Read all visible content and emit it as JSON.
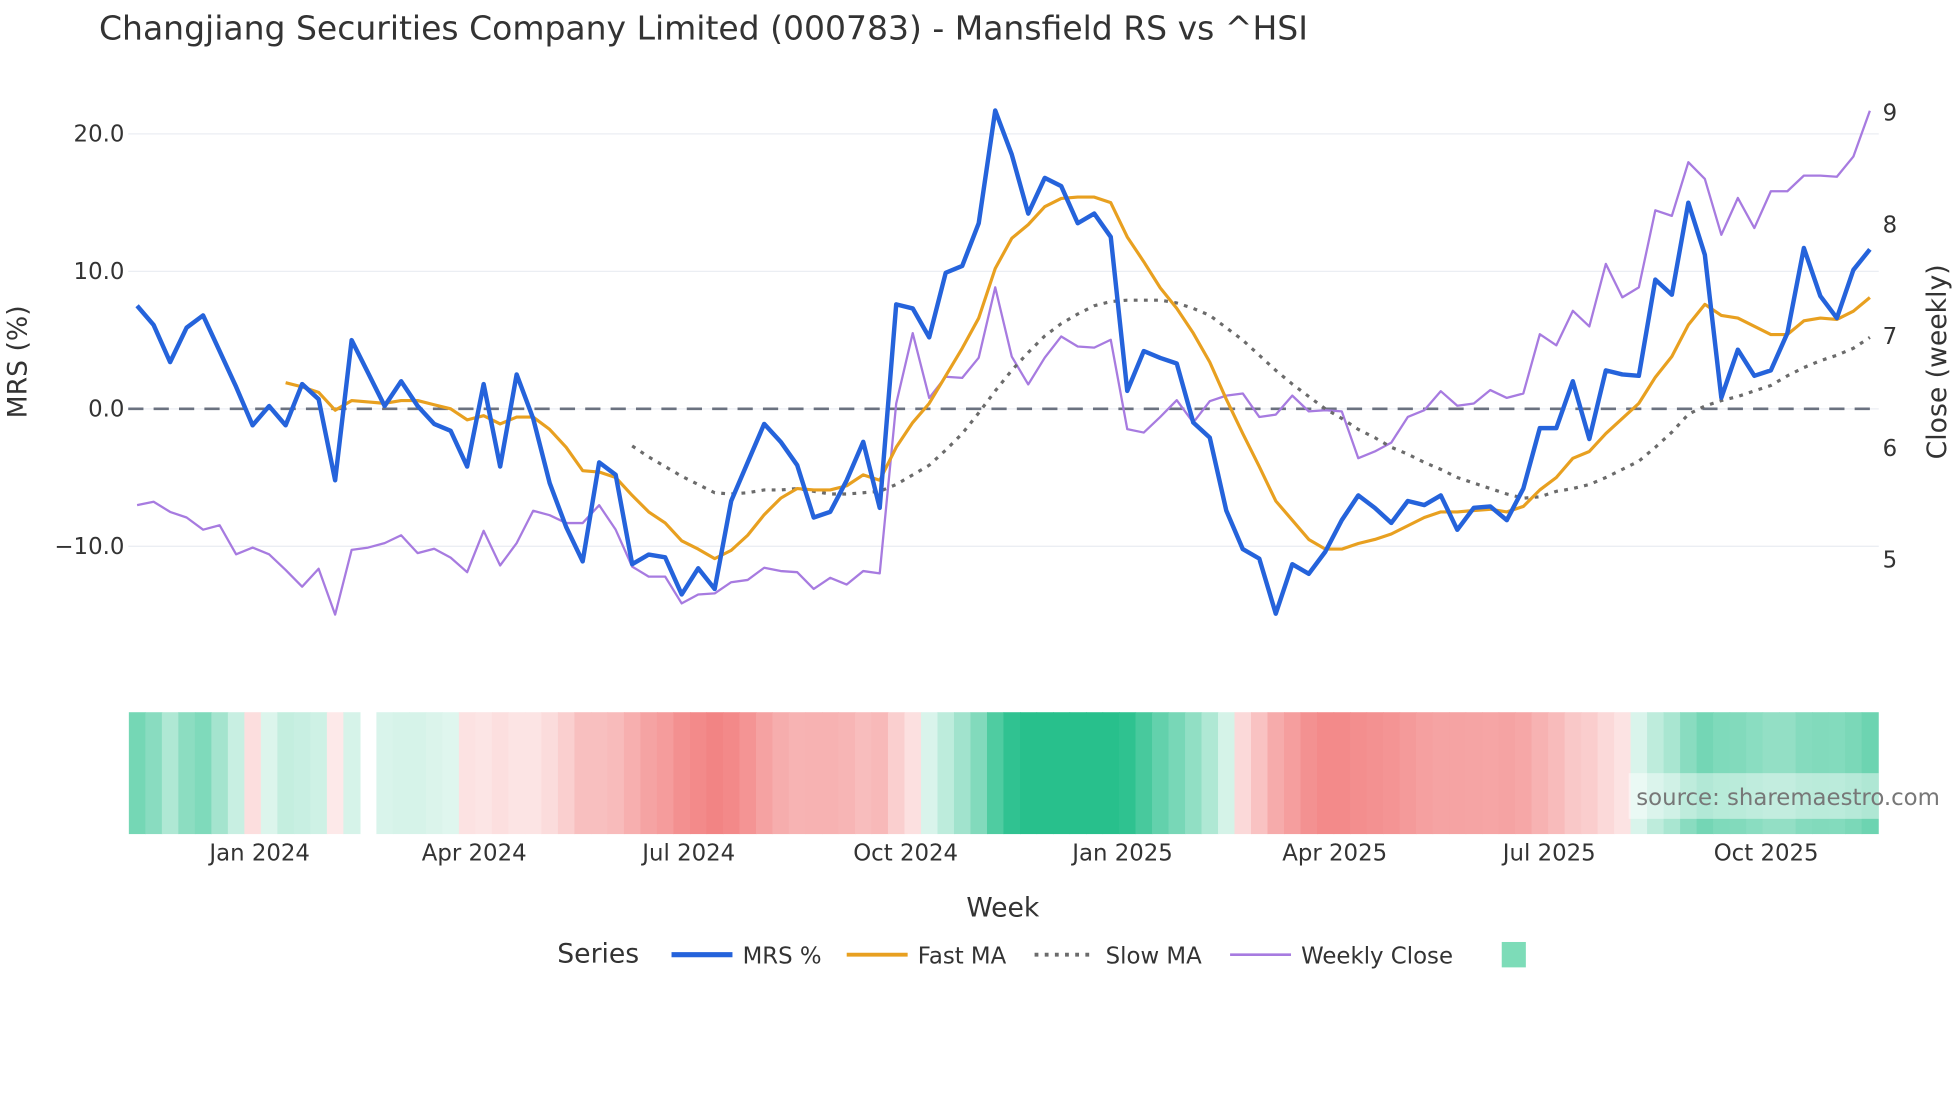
{
  "chart_data": {
    "type": "line",
    "title": "Changjiang Securities Company Limited (000783) - Mansfield RS vs ^HSI",
    "xlabel": "Week",
    "ylabel": "MRS (%)",
    "y2label": "Close (weekly)",
    "ylim": [
      -17.5,
      22.5
    ],
    "y2lim": [
      4.3,
      9.1
    ],
    "yticks": [
      {
        "v": 20,
        "label": "20.0"
      },
      {
        "v": 10,
        "label": "10.0"
      },
      {
        "v": 0,
        "label": "0.0"
      },
      {
        "v": -10,
        "label": "−10.0"
      }
    ],
    "y2ticks": [
      {
        "v": 9,
        "label": "9"
      },
      {
        "v": 8,
        "label": "8"
      },
      {
        "v": 7,
        "label": "7"
      },
      {
        "v": 6,
        "label": "6"
      },
      {
        "v": 5,
        "label": "5"
      }
    ],
    "xticks": [
      {
        "date": "2024-01-01",
        "label": "Jan 2024"
      },
      {
        "date": "2024-04-01",
        "label": "Apr 2024"
      },
      {
        "date": "2024-07-01",
        "label": "Jul 2024"
      },
      {
        "date": "2024-10-01",
        "label": "Oct 2024"
      },
      {
        "date": "2025-01-01",
        "label": "Jan 2025"
      },
      {
        "date": "2025-04-01",
        "label": "Apr 2025"
      },
      {
        "date": "2025-07-01",
        "label": "Jul 2025"
      },
      {
        "date": "2025-10-01",
        "label": "Oct 2025"
      }
    ],
    "first_week": "2023-11-10",
    "grid": true,
    "zero_line": true,
    "legend": {
      "title": "Series",
      "placement": "bottom-center"
    },
    "series": [
      {
        "name": "MRS %",
        "color": "#2563db",
        "values": [
          7.5,
          6.1,
          3.4,
          5.9,
          6.8,
          4.2,
          1.6,
          -1.2,
          0.2,
          -1.2,
          1.8,
          0.7,
          -5.2,
          5.0,
          2.6,
          0.2,
          2.0,
          0.2,
          -1.1,
          -1.6,
          -4.2,
          1.8,
          -4.2,
          2.5,
          -0.7,
          -5.4,
          -8.6,
          -11.1,
          -3.9,
          -4.8,
          -11.3,
          -10.6,
          -10.8,
          -13.5,
          -11.6,
          -13.1,
          -6.7,
          -3.9,
          -1.1,
          -2.4,
          -4.1,
          -7.9,
          -7.5,
          -5.2,
          -2.4,
          -7.2,
          7.6,
          7.3,
          5.2,
          9.9,
          10.4,
          13.5,
          21.7,
          18.5,
          14.2,
          16.8,
          16.2,
          13.5,
          14.2,
          12.5,
          1.3,
          4.2,
          3.7,
          3.3,
          -1.0,
          -2.1,
          -7.4,
          -10.2,
          -10.9,
          -14.9,
          -11.3,
          -12.0,
          -10.4,
          -8.1,
          -6.3,
          -7.2,
          -8.3,
          -6.7,
          -7.0,
          -6.3,
          -8.8,
          -7.2,
          -7.1,
          -8.1,
          -5.8,
          -1.4,
          -1.4,
          2.0,
          -2.2,
          2.8,
          2.5,
          2.4,
          9.4,
          8.3,
          15.0,
          11.2,
          0.8,
          4.3,
          2.4,
          2.8,
          5.5,
          11.7,
          8.2,
          6.6,
          10.1,
          11.6
        ]
      },
      {
        "name": "Fast MA",
        "color": "#e8a020",
        "values": [
          null,
          null,
          null,
          null,
          null,
          null,
          null,
          null,
          null,
          1.9,
          1.6,
          1.2,
          -0.1,
          0.6,
          0.5,
          0.4,
          0.6,
          0.6,
          0.3,
          0.0,
          -0.8,
          -0.5,
          -1.1,
          -0.6,
          -0.6,
          -1.5,
          -2.8,
          -4.5,
          -4.6,
          -5.0,
          -6.3,
          -7.5,
          -8.3,
          -9.6,
          -10.2,
          -10.9,
          -10.3,
          -9.2,
          -7.7,
          -6.5,
          -5.8,
          -5.9,
          -5.9,
          -5.6,
          -4.8,
          -5.2,
          -2.8,
          -1.0,
          0.4,
          2.4,
          4.4,
          6.6,
          10.2,
          12.4,
          13.4,
          14.7,
          15.3,
          15.4,
          15.4,
          15.0,
          12.5,
          10.7,
          8.8,
          7.3,
          5.5,
          3.4,
          0.7,
          -1.8,
          -4.2,
          -6.7,
          -8.1,
          -9.5,
          -10.2,
          -10.2,
          -9.8,
          -9.5,
          -9.1,
          -8.5,
          -7.9,
          -7.5,
          -7.5,
          -7.4,
          -7.3,
          -7.5,
          -7.1,
          -5.9,
          -5.0,
          -3.6,
          -3.1,
          -1.8,
          -0.7,
          0.4,
          2.3,
          3.8,
          6.1,
          7.6,
          6.8,
          6.6,
          6.0,
          5.4,
          5.4,
          6.4,
          6.6,
          6.5,
          7.1,
          8.1
        ]
      },
      {
        "name": "Slow MA",
        "color": "#6b6b6b",
        "dash": true,
        "values": [
          null,
          null,
          null,
          null,
          null,
          null,
          null,
          null,
          null,
          null,
          null,
          null,
          null,
          null,
          null,
          null,
          null,
          null,
          null,
          null,
          null,
          null,
          null,
          null,
          null,
          null,
          null,
          null,
          null,
          null,
          -2.7,
          -3.5,
          -4.2,
          -4.9,
          -5.5,
          -6.1,
          -6.2,
          -6.1,
          -5.9,
          -5.9,
          -5.8,
          -6.0,
          -6.2,
          -6.2,
          -6.1,
          -6.0,
          -5.5,
          -4.8,
          -4.1,
          -3.0,
          -1.8,
          -0.3,
          1.3,
          2.8,
          4.1,
          5.3,
          6.2,
          6.9,
          7.5,
          7.8,
          7.9,
          7.9,
          7.9,
          7.7,
          7.3,
          6.8,
          5.9,
          5.0,
          3.9,
          2.8,
          1.8,
          0.9,
          0.0,
          -0.7,
          -1.5,
          -2.1,
          -2.8,
          -3.3,
          -3.9,
          -4.4,
          -5.0,
          -5.4,
          -5.8,
          -6.2,
          -6.5,
          -6.4,
          -6.0,
          -5.8,
          -5.5,
          -5.0,
          -4.4,
          -3.8,
          -2.8,
          -1.7,
          -0.4,
          0.2,
          0.6,
          0.9,
          1.3,
          1.7,
          2.4,
          3.0,
          3.5,
          3.9,
          4.4,
          5.2
        ]
      },
      {
        "name": "Weekly Close",
        "color": "#a77be0",
        "axis": "right",
        "values": [
          5.49,
          5.52,
          5.43,
          5.38,
          5.27,
          5.31,
          5.05,
          5.11,
          5.05,
          4.91,
          4.76,
          4.92,
          4.51,
          5.09,
          5.11,
          5.15,
          5.22,
          5.06,
          5.1,
          5.02,
          4.89,
          5.26,
          4.95,
          5.15,
          5.44,
          5.4,
          5.33,
          5.33,
          5.49,
          5.27,
          4.94,
          4.85,
          4.85,
          4.61,
          4.69,
          4.7,
          4.8,
          4.82,
          4.93,
          4.9,
          4.89,
          4.74,
          4.84,
          4.78,
          4.9,
          4.88,
          6.4,
          7.03,
          6.45,
          6.64,
          6.63,
          6.81,
          7.44,
          6.82,
          6.57,
          6.81,
          7.0,
          6.91,
          6.9,
          6.97,
          6.17,
          6.14,
          6.28,
          6.43,
          6.23,
          6.42,
          6.47,
          6.49,
          6.28,
          6.3,
          6.47,
          6.33,
          6.34,
          6.33,
          5.91,
          5.97,
          6.05,
          6.28,
          6.34,
          6.51,
          6.38,
          6.4,
          6.52,
          6.45,
          6.49,
          7.02,
          6.92,
          7.23,
          7.09,
          7.65,
          7.35,
          7.44,
          8.13,
          8.08,
          8.56,
          8.41,
          7.91,
          8.24,
          7.97,
          8.3,
          8.3,
          8.44,
          8.44,
          8.43,
          8.61,
          9.02
        ]
      }
    ],
    "heatmap": {
      "based_on": "Fast MA (MRS before available)",
      "missing_weeks": [
        14
      ],
      "pos_color": "#28c08c",
      "neg_color": "#f07070",
      "scale_max": 13
    },
    "legend_swatch_color": "#7ddcb8",
    "annotation": "source: sharemaestro.com"
  }
}
